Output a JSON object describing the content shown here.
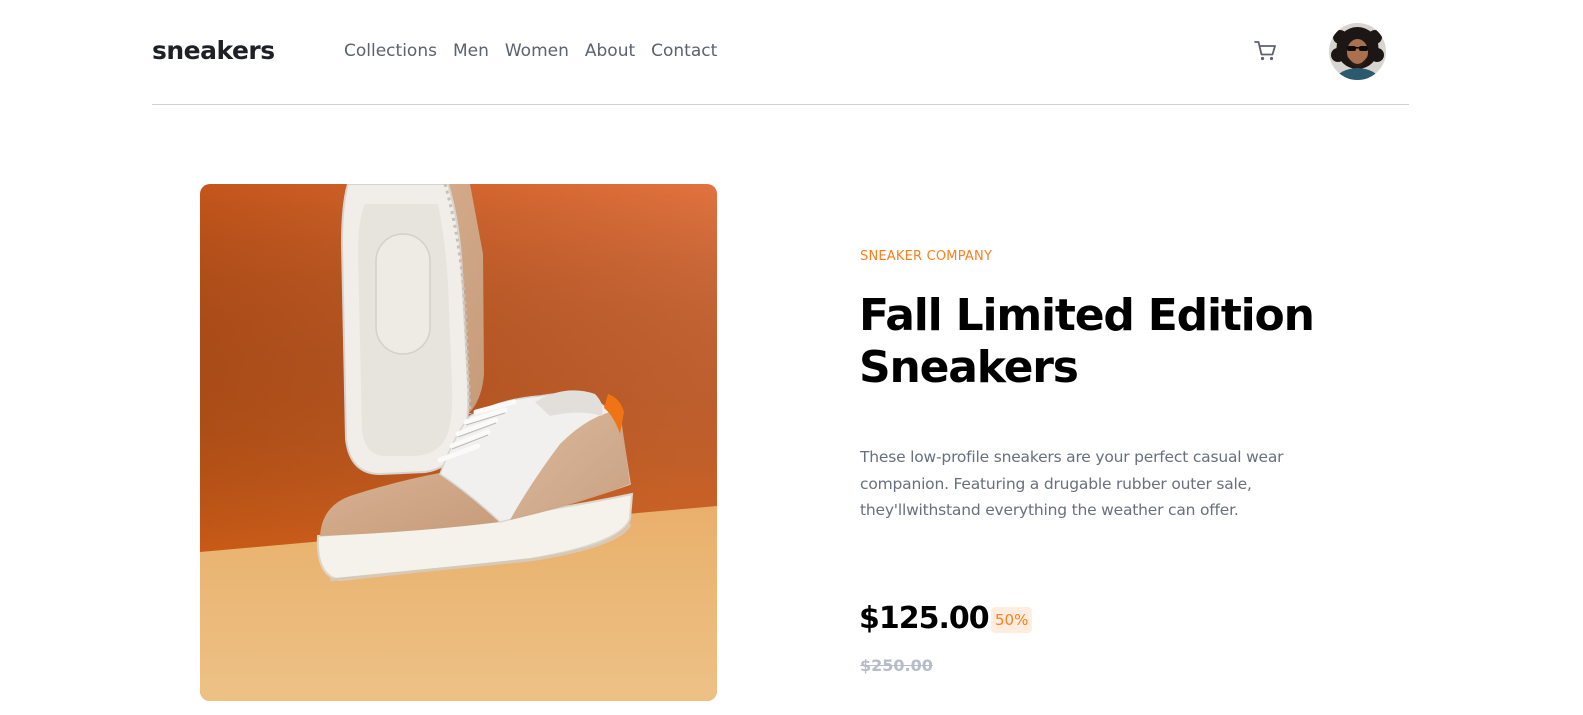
{
  "header": {
    "logo": "sneakers",
    "nav": [
      "Collections",
      "Men",
      "Women",
      "About",
      "Contact"
    ],
    "cart_icon": "cart-icon",
    "avatar_icon": "avatar"
  },
  "product": {
    "company": "SNEAKER COMPANY",
    "title": "Fall Limited Edition Sneakers",
    "description": "These low-profile sneakers are your perfect casual wear companion. Featuring a drugable rubber outer sale, they'llwithstand everything the weather can offer.",
    "price": "$125.00",
    "discount": "50%",
    "original_price": "$250.00"
  },
  "colors": {
    "accent": "#ff7e1b",
    "accent_light": "#ffede0",
    "dark": "#1d2026",
    "text": "#68707d",
    "muted": "#b6bcc8"
  }
}
